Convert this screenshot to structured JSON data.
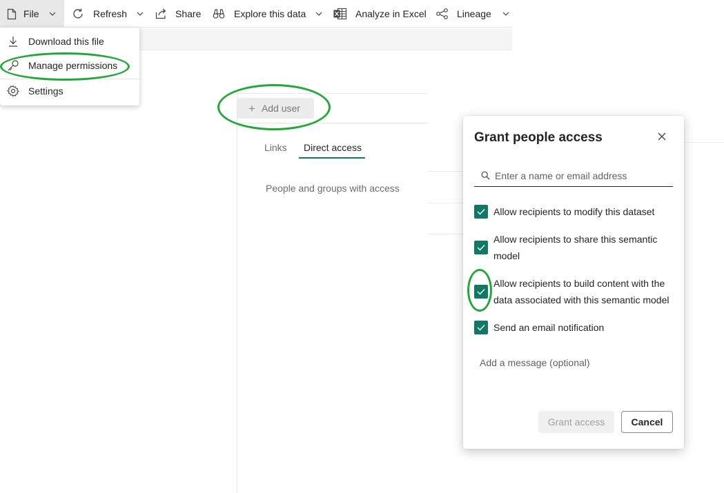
{
  "toolbar": {
    "file_label": "File",
    "refresh_label": "Refresh",
    "share_label": "Share",
    "explore_label": "Explore this data",
    "analyze_label": "Analyze in Excel",
    "lineage_label": "Lineage"
  },
  "file_menu": {
    "items": [
      {
        "label": "Download this file",
        "icon": "download-icon"
      },
      {
        "label": "Manage permissions",
        "icon": "key-icon"
      },
      {
        "label": "Settings",
        "icon": "gear-icon"
      }
    ]
  },
  "permissions_panel": {
    "add_user_label": "Add user",
    "tabs": [
      {
        "label": "Links",
        "active": false
      },
      {
        "label": "Direct access",
        "active": true
      }
    ],
    "section_title": "People and groups with access"
  },
  "dialog": {
    "title": "Grant people access",
    "search_placeholder": "Enter a name or email address",
    "options": [
      {
        "label": "Allow recipients to modify this dataset",
        "checked": true
      },
      {
        "label": "Allow recipients to share this semantic model",
        "checked": true
      },
      {
        "label": "Allow recipients to build content with the data associated with this semantic model",
        "checked": true
      },
      {
        "label": "Send an email notification",
        "checked": true
      }
    ],
    "message_placeholder": "Add a message (optional)",
    "grant_label": "Grant access",
    "cancel_label": "Cancel"
  },
  "colors": {
    "accent": "#117865",
    "annotation": "#22a838"
  }
}
